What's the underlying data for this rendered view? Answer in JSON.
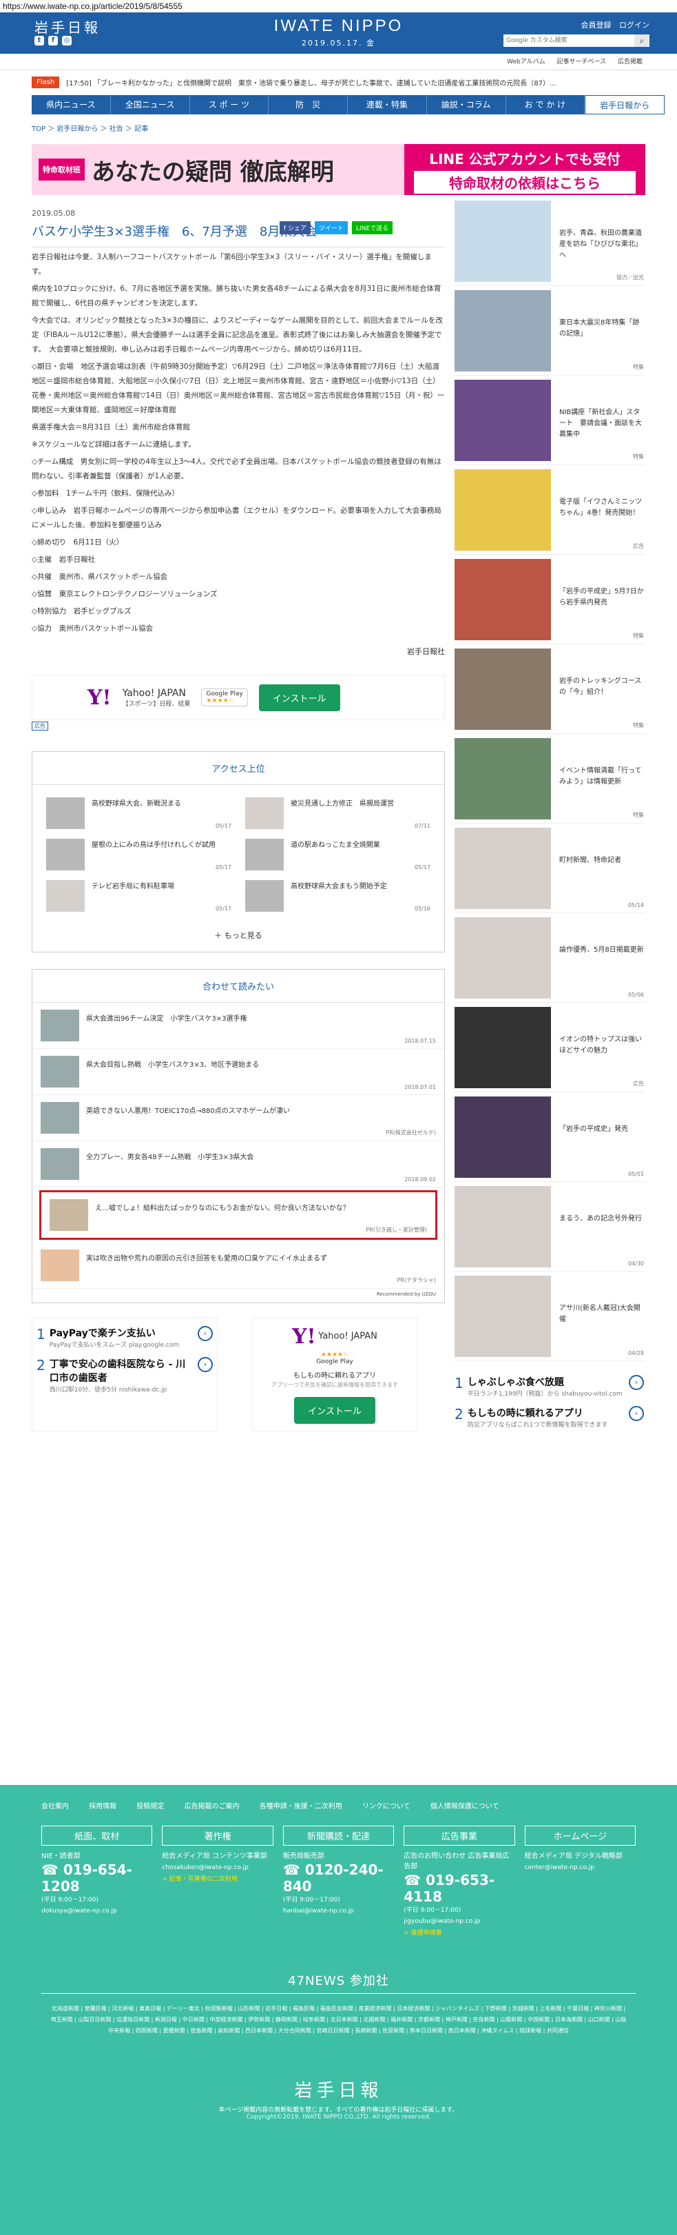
{
  "url": "https://www.iwate-np.co.jp/article/2019/5/8/54555",
  "header": {
    "logo": "岩手日報",
    "title": "IWATE NIPPO",
    "date": "2019.05.17. 金",
    "member": "会員登録",
    "login": "ログイン",
    "search_placeholder": "Google カスタム検索"
  },
  "subnav": [
    "Webアルバム",
    "記事サーチベース",
    "広告掲載"
  ],
  "flash": {
    "tag": "Flash",
    "text": "[17:50] 「ブレーキ利かなかった」と伐倒機関で説明　東京・池袋で乗り暴走し、母子が死亡した事故で、逮捕していた旧通産省工業技術院の元院長（87）..."
  },
  "nav": [
    "県内ニュース",
    "全国ニュース",
    "ス ポ ー ツ",
    "防　災",
    "連載・特集",
    "論説・コラム",
    "お で か け",
    "岩手日報から"
  ],
  "breadcrumb": "TOP ＞ 岩手日報から ＞ 社告 ＞ 記事",
  "banner": {
    "q": "特命取材班",
    "left": "あなたの疑問 徹底解明",
    "right1": "LINE 公式アカウントでも受付",
    "right2": "特命取材の依頼はこちら"
  },
  "article": {
    "date": "2019.05.08",
    "share": [
      "f シェア",
      "ツイート",
      "LINEで送る"
    ],
    "title": "バスケ小学生3×3選手権　6、7月予選　8月県大会",
    "paras": [
      "岩手日報社は今夏、3人制ハーフコートバスケットボール「第6回小学生3×3（スリー・バイ・スリー）選手権」を開催します。",
      "県内を10ブロックに分け、6、7月に各地区予選を実施。勝ち抜いた男女各48チームによる県大会を8月31日に奥州市総合体育館で開催し、6代目の県チャンピオンを決定します。",
      "今大会では、オリンピック競技となった3×3の種目に、よりスピーディーなゲーム展開を目的として、前回大会までルールを改定（FIBAルールU12に準拠）。県大会優勝チームは選手全員に記念品を進呈。表彰式終了後にはお楽しみ大抽選会を開催予定です。　大会要項と競技規則、申し込みは岩手日報ホームページ内専用ページから。締め切りは6月11日。",
      "◇期日・会場　地区予選会場は別表（午前9時30分開始予定）▽6月29日（土）二戸地区＝浄法寺体育館▽7月6日（土）大船渡地区＝盛岡市総合体育館、大船地区＝小久保小▽7日（日）北上地区＝奥州市体育館、宮古・遠野地区＝小佐野小▽13日（土）花巻・奥州地区＝奥州総合体育館▽14日（日）奥州地区＝奥州総合体育館、宮古地区＝宮古市民総合体育館▽15日（月・祝）一関地区＝大東体育館、盛岡地区＝好摩体育館",
      "県選手権大会＝8月31日（土）奥州市総合体育館",
      "※スケジュールなど詳細は各チームに連絡します。",
      "◇チーム構成　男女別に同一学校の4年生以上3～4人。交代で必ず全員出場。日本バスケットボール協会の競技者登録の有無は問わない。引率者兼監督（保護者）が1人必要。",
      "◇参加料　1チーム千円（飲料、保険代込み）",
      "◇申し込み　岩手日報ホームページの専用ページから参加申込書（エクセル）をダウンロード。必要事項を入力して大会事務局にメールした後、参加料を郵便振り込み",
      "◇締め切り　6月11日（火）",
      "◇主催　岩手日報社",
      "◇共催　奥州市、県バスケットボール協会",
      "◇協賛　東京エレクトロンテクノロジーソリューションズ",
      "◇特別協力　岩手ビッグブルズ",
      "◇協力　奥州市バスケットボール協会"
    ],
    "byline": "岩手日報社"
  },
  "yahoo": {
    "logo": "Y!",
    "title": "Yahoo! JAPAN",
    "sub": "【スポーツ】日程、結果",
    "gp": "Google Play",
    "stars": "★★★★☆",
    "install": "インストール",
    "adlabel": "広告"
  },
  "ranking": {
    "title": "アクセス上位",
    "items": [
      {
        "t": "高校野球県大会、新戦況まる",
        "d": "05/17"
      },
      {
        "t": "被災見通し上方修正　県親局運営",
        "d": "07/11"
      },
      {
        "t": "屋根の上にみの鳥は手付けれしくが試用",
        "d": "05/17"
      },
      {
        "t": "道の駅あねっこたま全焼開業",
        "d": "05/17"
      },
      {
        "t": "テレビ岩手局に有料駐車場",
        "d": "05/17"
      },
      {
        "t": "高校野球県大会まもう開始予定",
        "d": "05/16"
      }
    ],
    "more": "もっと見る"
  },
  "related": {
    "title": "合わせて読みたい",
    "items": [
      {
        "t": "県大会進出96チーム決定　小学生バスケ3×3選手権",
        "d": "2018.07.15"
      },
      {
        "t": "県大会目指し熱戦　小学生バスケ3×3、地区予選始まる",
        "d": "2018.07.01"
      },
      {
        "t": "英語できない人悪用！TOEIC170点→880点のスマホゲームが凄い",
        "d": "PR(株式会社ゼルテ)"
      },
      {
        "t": "全力プレー、男女各48チーム熱戦　小学生3×3県大会",
        "d": "2018.09.02"
      },
      {
        "t": "え…嘘でしょ！給料出たばっかりなのにもうお金がない。何か良い方法ないかな？",
        "d": "PR(引き越し・家計管理)"
      },
      {
        "t": "実は吹き出物や荒れの原因の元引き回答をも愛用の口臭ケアにイイ水止まるず",
        "d": "PR(ナタラシャ)"
      }
    ],
    "by": "Recommended by UZOU"
  },
  "ads": [
    {
      "n": "1",
      "t": "PayPayで楽チン支払い",
      "s": "PayPayで支払いをスムーズ\nplay.google.com"
    },
    {
      "n": "2",
      "t": "丁寧で安心の歯科医院なら - 川口市の歯医者",
      "s": "西川口駅10分、徒歩5分\nnishikawa-dc.jp"
    }
  ],
  "yahoo2": {
    "logo": "Y!",
    "title": "Yahoo! JAPAN",
    "stars": "★★★★☆",
    "gp": "Google Play",
    "d1": "もしもの時に頼れるアプリ",
    "d2": "アプリ一つで天気を確認に最新情報を取得できます",
    "install": "インストール"
  },
  "side": [
    {
      "t": "岩手、青森、秋田の農業遺産を訪ね「ひびびな東北」へ",
      "lab": "協力／出光"
    },
    {
      "t": "東日本大震災8年特集「跡の記憶」",
      "lab": "特集"
    },
    {
      "t": "NIB講座「新社会人」スタート　要請会議・面談を大募集中",
      "lab": "特集"
    },
    {
      "t": "電子版「イワさんミニッツちゃん」4巻！発売開始！",
      "lab": "広告"
    },
    {
      "t": "「岩手の平成史」5月7日から岩手県内発売",
      "lab": "特集"
    },
    {
      "t": "岩手のトレッキングコースの「今」紹介！",
      "lab": "特集"
    },
    {
      "t": "イベント情報満載「行ってみよう」は情報更新",
      "lab": "特集"
    },
    {
      "t": "町村新聞、特命記者",
      "lab": "05/14"
    },
    {
      "t": "論作優秀、5月8日掲載更新",
      "lab": "05/06"
    },
    {
      "t": "イオンの特トップスは強いほどサイの魅力",
      "lab": "広告"
    },
    {
      "t": "「岩手の平成史」発売",
      "lab": "05/01"
    },
    {
      "t": "まるう、あの記念号外発行",
      "lab": "04/30"
    },
    {
      "t": "アサ川(新名人戴冠)大会開催",
      "lab": "04/28"
    }
  ],
  "sideads": [
    {
      "n": "1",
      "t": "しゃぶしゃぶ食べ放題",
      "s": "平日ランチ1,199円（税抜）から\nshabuyou-vitol.com"
    },
    {
      "n": "2",
      "t": "もしもの時に頼れるアプリ",
      "s": "防災アプリならばこれ1つで新情報を取得できます"
    }
  ],
  "footer": {
    "links": [
      "会社案内",
      "採用情報",
      "投稿規定",
      "広告掲載のご案内",
      "各種申請・後援・二次利用",
      "リンクについて",
      "個人情報保護について"
    ],
    "cols": [
      {
        "hd": "紙面、取材",
        "sub": "NIE・読者部",
        "tel": "☎ 019-654-1208",
        "hrs": "(平日 9:00－17:00)",
        "mail": "dokusya@iwate-np.co.jp",
        "lnk": ""
      },
      {
        "hd": "著作権",
        "sub": "総合メディア局 コンテンツ事業部",
        "tel": "",
        "hrs": "",
        "mail": "chosakuken@iwate-np.co.jp",
        "lnk": "> 記事・写真等の二次利用"
      },
      {
        "hd": "新聞購読・配達",
        "sub": "販売局販売部",
        "tel": "☎ 0120-240-840",
        "hrs": "(平日 9:00－17:00)",
        "mail": "hanbai@iwate-np.co.jp",
        "lnk": ""
      },
      {
        "hd": "広告事業",
        "sub": "広告のお問い合わせ 広告事業局広告部",
        "tel": "☎ 019-653-4118",
        "hrs": "(平日 9:00－17:00)",
        "mail": "jigyoubu@iwate-np.co.jp",
        "lnk": "> 後援申請書"
      },
      {
        "hd": "ホームページ",
        "sub": "総合メディア局 デジタル戦略部",
        "tel": "",
        "hrs": "",
        "mail": "center@iwate-np.co.jp",
        "lnk": ""
      }
    ],
    "n47": "47NEWS 参加社",
    "papers": "北海道新聞 | 室蘭民報 | 河北新報 | 東奥日報 | デーリー東北 | 秋田魁新報 | 山形新聞 | 岩手日報 | 福島民報 | 福島民友新聞 | 産業経済新聞 | 日本経済新聞 | ジャパンタイムズ | 下野新聞 | 茨城新聞 | 上毛新聞 | 千葉日報 | 神奈川新聞 | 埼玉新聞 | 山梨日日新聞 | 信濃毎日新聞 | 新潟日報 | 中日新聞 | 中部経済新聞 | 伊勢新聞 | 静岡新聞 | 岐阜新聞 | 北日本新聞 | 北國新聞 | 福井新聞 | 京都新聞 | 神戸新聞 | 奈良新聞 | 山陽新聞 | 中国新聞 | 日本海新聞 | 山口新聞 | 山陰中央新報 | 四国新聞 | 愛媛新聞 | 徳島新聞 | 高知新聞 | 西日本新聞 | 大分合同新聞 | 宮崎日日新聞 | 長崎新聞 | 佐賀新聞 | 熊本日日新聞 | 南日本新聞 | 沖縄タイムス | 琉球新報 | 共同通信",
    "logo": "岩手日報",
    "note": "本ページ掲載内容の無断転載を禁じます。すべての著作権は岩手日報社に帰属します。",
    "copy": "Copyright©2019, IWATE NIPPO CO.,LTD. All rights reserved."
  }
}
